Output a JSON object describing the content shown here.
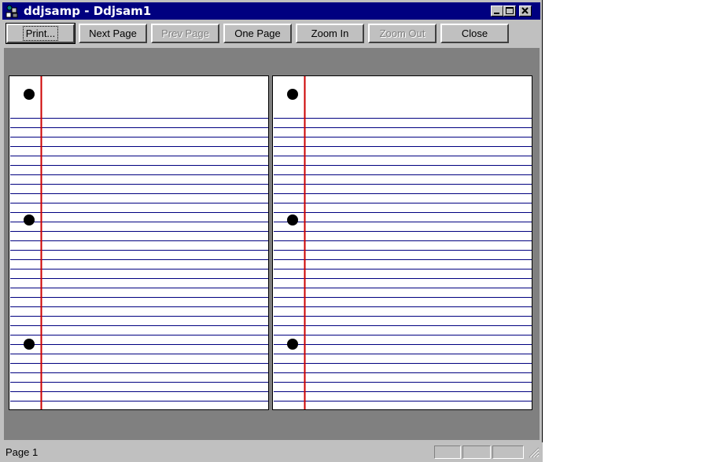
{
  "window": {
    "title": "ddjsamp - Ddjsam1",
    "controls": {
      "minimize": "minimize-icon",
      "maximize": "maximize-icon",
      "close": "close-icon"
    }
  },
  "toolbar": {
    "buttons": [
      {
        "label": "Print...",
        "enabled": true,
        "default": true
      },
      {
        "label": "Next Page",
        "enabled": true
      },
      {
        "label": "Prev Page",
        "enabled": false
      },
      {
        "label": "One Page",
        "enabled": true
      },
      {
        "label": "Zoom In",
        "enabled": true
      },
      {
        "label": "Zoom Out",
        "enabled": false
      },
      {
        "label": "Close",
        "enabled": true
      }
    ]
  },
  "preview": {
    "pages": [
      {
        "style": "ruled-notebook-paper",
        "holes": 3
      },
      {
        "style": "ruled-notebook-paper",
        "holes": 3
      }
    ],
    "colors": {
      "rule": "#000080",
      "margin": "#cc0000",
      "background": "#808080"
    }
  },
  "statusbar": {
    "text": "Page 1"
  }
}
